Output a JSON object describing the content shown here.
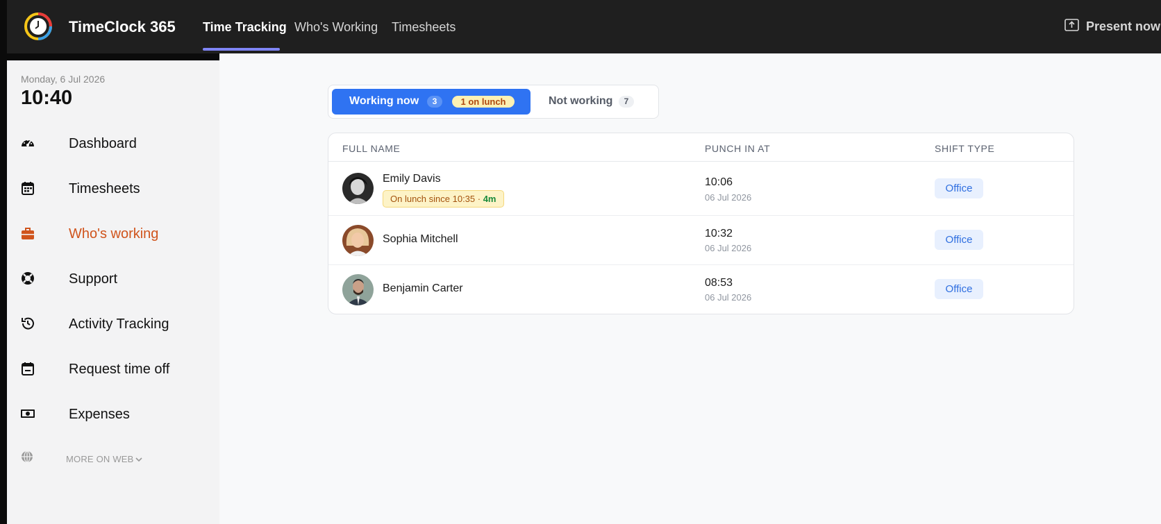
{
  "app": {
    "title": "TimeClock 365"
  },
  "header": {
    "tabs": [
      {
        "label": "Time Tracking",
        "active": true
      },
      {
        "label": "Who's Working",
        "active": false
      },
      {
        "label": "Timesheets",
        "active": false
      }
    ],
    "present_label": "Present now"
  },
  "sidebar": {
    "date": "Monday, 6 Jul 2026",
    "time": "10:40",
    "items": [
      {
        "label": "Dashboard",
        "icon": "speedometer-icon"
      },
      {
        "label": "Timesheets",
        "icon": "calendar-icon"
      },
      {
        "label": "Who's working",
        "icon": "briefcase-icon",
        "active": true
      },
      {
        "label": "Support",
        "icon": "lifebuoy-icon"
      },
      {
        "label": "Activity Tracking",
        "icon": "history-icon"
      },
      {
        "label": "Request time off",
        "icon": "calendar-remove-icon"
      },
      {
        "label": "Expenses",
        "icon": "money-icon"
      }
    ],
    "more_label": "MORE ON WEB",
    "active_color": "#d0541c"
  },
  "filter": {
    "working": {
      "label": "Working now",
      "count": "3",
      "lunch_badge": "1 on lunch"
    },
    "not_working": {
      "label": "Not working",
      "count": "7"
    },
    "accent": "#2f73f2"
  },
  "table": {
    "headers": [
      "FULL NAME",
      "PUNCH IN AT",
      "SHIFT TYPE"
    ],
    "rows": [
      {
        "name": "Emily Davis",
        "lunch_status": "On lunch since 10:35 ·",
        "lunch_duration": "4m",
        "punch_time": "10:06",
        "punch_date": "06 Jul 2026",
        "shift": "Office"
      },
      {
        "name": "Sophia Mitchell",
        "punch_time": "10:32",
        "punch_date": "06 Jul 2026",
        "shift": "Office"
      },
      {
        "name": "Benjamin Carter",
        "punch_time": "08:53",
        "punch_date": "06 Jul 2026",
        "shift": "Office"
      }
    ]
  }
}
